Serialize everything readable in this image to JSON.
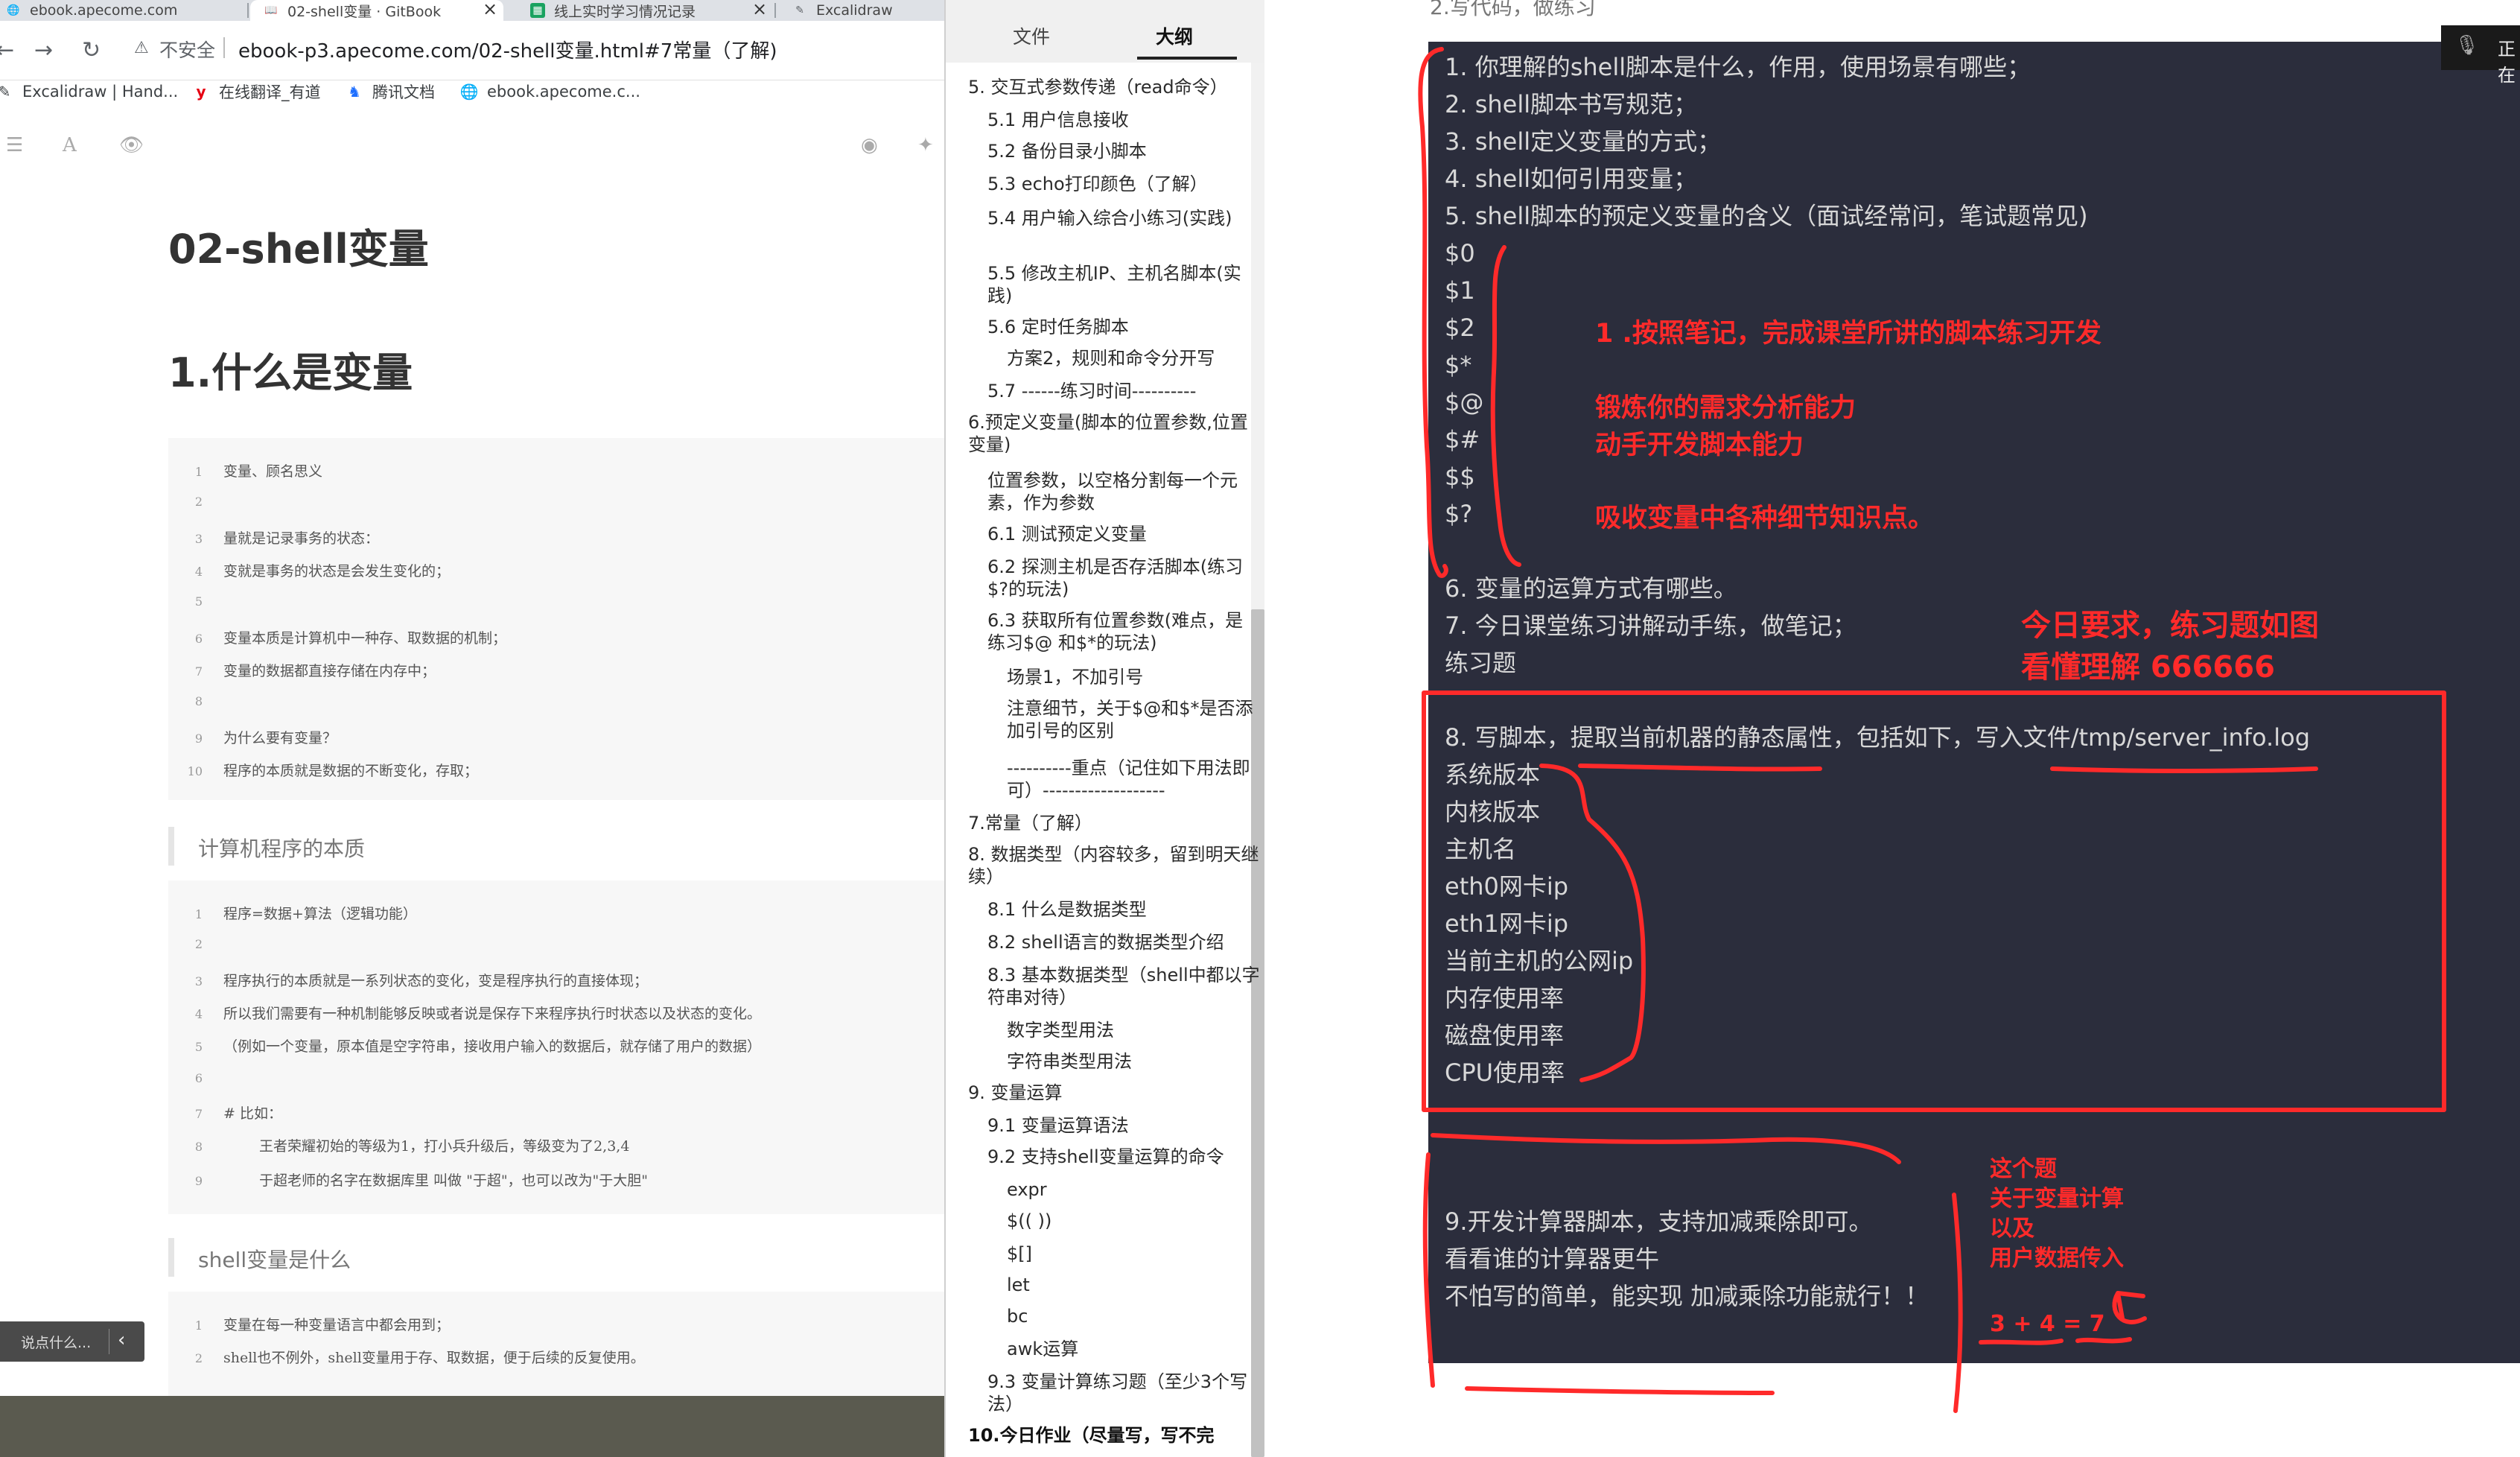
{
  "browser": {
    "tabs": [
      {
        "title": "ebook.apecome.com",
        "icon": "globe-icon"
      },
      {
        "title": "02-shell变量 · GitBook",
        "icon": "book-icon"
      },
      {
        "title": "线上实时学习情况记录",
        "icon": "sheet-icon"
      },
      {
        "title": "Excalidraw",
        "icon": "excalidraw-icon"
      }
    ],
    "security_label": "不安全",
    "url": "ebook-p3.apecome.com/02-shell变量.html#7常量（了解)",
    "bookmarks": [
      {
        "label": "Excalidraw | Hand...",
        "icon": "excalidraw-icon"
      },
      {
        "label": "在线翻译_有道",
        "icon": "youdao-icon"
      },
      {
        "label": "腾讯文档",
        "icon": "tencent-docs-icon"
      },
      {
        "label": "ebook.apecome.c...",
        "icon": "globe-icon"
      }
    ]
  },
  "article": {
    "title": "02-shell变量",
    "section_heading": "1.什么是变量",
    "block1": [
      {
        "n": "1",
        "t": "变量、顾名思义"
      },
      {
        "n": "2",
        "t": ""
      },
      {
        "n": "3",
        "t": "量就是记录事务的状态："
      },
      {
        "n": "4",
        "t": "变就是事务的状态是会发生变化的；"
      },
      {
        "n": "5",
        "t": ""
      },
      {
        "n": "6",
        "t": "变量本质是计算机中一种存、取数据的机制；"
      },
      {
        "n": "7",
        "t": "变量的数据都直接存储在内存中；"
      },
      {
        "n": "8",
        "t": ""
      },
      {
        "n": "9",
        "t": "为什么要有变量？"
      },
      {
        "n": "10",
        "t": "程序的本质就是数据的不断变化，存取；"
      }
    ],
    "quote1": "计算机程序的本质",
    "block2": [
      {
        "n": "1",
        "t": "程序=数据+算法（逻辑功能）"
      },
      {
        "n": "2",
        "t": ""
      },
      {
        "n": "3",
        "t": "程序执行的本质就是一系列状态的变化，变是程序执行的直接体现；"
      },
      {
        "n": "4",
        "t": "所以我们需要有一种机制能够反映或者说是保存下来程序执行时状态以及状态的变化。"
      },
      {
        "n": "5",
        "t": "（例如一个变量，原本值是空字符串，接收用户输入的数据后，就存储了用户的数据）"
      },
      {
        "n": "6",
        "t": ""
      },
      {
        "n": "7",
        "t": "# 比如："
      },
      {
        "n": "8",
        "t": "王者荣耀初始的等级为1，打小兵升级后，等级变为了2,3,4"
      },
      {
        "n": "9",
        "t": "于超老师的名字在数据库里 叫做 \"于超\"，也可以改为\"于大胆\""
      }
    ],
    "quote2": "shell变量是什么",
    "block3": [
      {
        "n": "1",
        "t": "变量在每一种变量语言中都会用到；"
      },
      {
        "n": "2",
        "t": "shell也不例外，shell变量用于存、取数据，便于后续的反复使用。"
      }
    ],
    "comment_button": "说点什么..."
  },
  "outline": {
    "tab_files": "文件",
    "tab_outline": "大纲",
    "items": [
      {
        "t": "5. 交互式参数传递（read命令）",
        "lvl": 1
      },
      {
        "t": "5.1 用户信息接收",
        "lvl": 2
      },
      {
        "t": "5.2 备份目录小脚本",
        "lvl": 2
      },
      {
        "t": "5.3 echo打印颜色（了解）",
        "lvl": 2
      },
      {
        "t": "5.4 用户输入综合小练习(实践)",
        "lvl": 2
      },
      {
        "t": "5.5 修改主机IP、主机名脚本(实践)",
        "lvl": 2
      },
      {
        "t": "5.6 定时任务脚本",
        "lvl": 2
      },
      {
        "t": "方案2，规则和命令分开写",
        "lvl": 3
      },
      {
        "t": "5.7 ------练习时间----------",
        "lvl": 2
      },
      {
        "t": "6.预定义变量(脚本的位置参数,位置变量)",
        "lvl": 1
      },
      {
        "t": "位置参数，以空格分割每一个元素，作为参数",
        "lvl": 2
      },
      {
        "t": "6.1 测试预定义变量",
        "lvl": 2
      },
      {
        "t": "6.2 探测主机是否存活脚本(练习$?的玩法)",
        "lvl": 2
      },
      {
        "t": "6.3 获取所有位置参数(难点，是练习$@ 和$*的玩法)",
        "lvl": 2
      },
      {
        "t": "场景1，不加引号",
        "lvl": 3
      },
      {
        "t": "注意细节，关于$@和$*是否添加引号的区别",
        "lvl": 3
      },
      {
        "t": "----------重点（记住如下用法即可）-------------------",
        "lvl": 3
      },
      {
        "t": "7.常量（了解）",
        "lvl": 1
      },
      {
        "t": "8. 数据类型（内容较多，留到明天继续）",
        "lvl": 1
      },
      {
        "t": "8.1 什么是数据类型",
        "lvl": 2
      },
      {
        "t": "8.2 shell语言的数据类型介绍",
        "lvl": 2
      },
      {
        "t": "8.3 基本数据类型（shell中都以字符串对待）",
        "lvl": 2
      },
      {
        "t": "数字类型用法",
        "lvl": 3
      },
      {
        "t": "字符串类型用法",
        "lvl": 3
      },
      {
        "t": "9. 变量运算",
        "lvl": 1
      },
      {
        "t": "9.1 变量运算语法",
        "lvl": 2
      },
      {
        "t": "9.2 支持shell变量运算的命令",
        "lvl": 2
      },
      {
        "t": "expr",
        "lvl": 3
      },
      {
        "t": "$(( ))",
        "lvl": 3
      },
      {
        "t": "$[]",
        "lvl": 3
      },
      {
        "t": "let",
        "lvl": 3
      },
      {
        "t": "bc",
        "lvl": 3
      },
      {
        "t": "awk运算",
        "lvl": 3
      },
      {
        "t": "9.3 变量计算练习题（至少3个写法）",
        "lvl": 2
      },
      {
        "t": "10.今日作业（尽量写，写不完",
        "lvl": 1,
        "bold": true
      }
    ]
  },
  "video": {
    "top_text": "2.写代码，做练习",
    "mic_text": "正在",
    "lines": [
      "1. 你理解的shell脚本是什么，作用，使用场景有哪些；",
      "2. shell脚本书写规范；",
      "3. shell定义变量的方式；",
      "4. shell如何引用变量；",
      "5. shell脚本的预定义变量的含义（面试经常问，笔试题常见)",
      "$0",
      "$1",
      "$2",
      "$*",
      "$@",
      "$#",
      "$$",
      "$?",
      "6. 变量的运算方式有哪些。",
      "7. 今日课堂练习讲解动手练，做笔记；",
      "练习题",
      "8. 写脚本，提取当前机器的静态属性，包括如下，写入文件/tmp/server_info.log",
      "系统版本",
      "内核版本",
      "主机名",
      "eth0网卡ip",
      "eth1网卡ip",
      "当前主机的公网ip",
      "内存使用率",
      "磁盘使用率",
      "CPU使用率",
      "9.开发计算器脚本，支持加减乘除即可。",
      "看看谁的计算器更牛",
      "不怕写的简单，能实现 加减乘除功能就行！！"
    ],
    "annotations": {
      "a1": "1 .按照笔记，完成课堂所讲的脚本练习开发",
      "a2": "锻炼你的需求分析能力",
      "a3": "动手开发脚本能力",
      "a4": "吸收变量中各种细节知识点。",
      "a5": "今日要求，练习题如图",
      "a6": "看懂理解  666666",
      "a7": "这个题",
      "a8": "关于变量计算",
      "a9": "以及",
      "a10": "用户数据传入",
      "a11": "3 + 4 = 7"
    }
  },
  "colors": {
    "annotation_red": "#ff2a2a",
    "terminal_bg": "#2b2d3c",
    "terminal_text": "#d8d8d8"
  }
}
